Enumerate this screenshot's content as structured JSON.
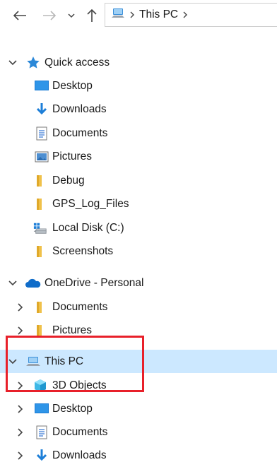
{
  "toolbar": {
    "back_icon": "back-arrow-icon",
    "forward_icon": "forward-arrow-icon",
    "recent_icon": "chevron-down-icon",
    "up_icon": "up-arrow-icon",
    "address": {
      "icon": "this-pc-icon",
      "crumb": "This PC"
    }
  },
  "tree": {
    "quick_access": {
      "label": "Quick access",
      "items": [
        {
          "label": "Desktop",
          "icon": "desktop-icon"
        },
        {
          "label": "Downloads",
          "icon": "downloads-icon"
        },
        {
          "label": "Documents",
          "icon": "documents-icon"
        },
        {
          "label": "Pictures",
          "icon": "pictures-icon"
        },
        {
          "label": "Debug",
          "icon": "folder-icon"
        },
        {
          "label": "GPS_Log_Files",
          "icon": "folder-icon"
        },
        {
          "label": "Local Disk (C:)",
          "icon": "local-disk-icon"
        },
        {
          "label": "Screenshots",
          "icon": "folder-icon"
        }
      ]
    },
    "onedrive": {
      "label": "OneDrive - Personal",
      "items": [
        {
          "label": "Documents",
          "icon": "folder-icon"
        },
        {
          "label": "Pictures",
          "icon": "folder-icon"
        }
      ]
    },
    "this_pc": {
      "label": "This PC",
      "items": [
        {
          "label": "3D Objects",
          "icon": "3d-objects-icon"
        },
        {
          "label": "Desktop",
          "icon": "desktop-icon"
        },
        {
          "label": "Documents",
          "icon": "documents-icon"
        },
        {
          "label": "Downloads",
          "icon": "downloads-icon"
        }
      ]
    }
  },
  "colors": {
    "selection": "#cce8ff",
    "highlight_box": "#e8202a",
    "folder": "#f0c14a",
    "accent_blue": "#1e7fd8"
  }
}
